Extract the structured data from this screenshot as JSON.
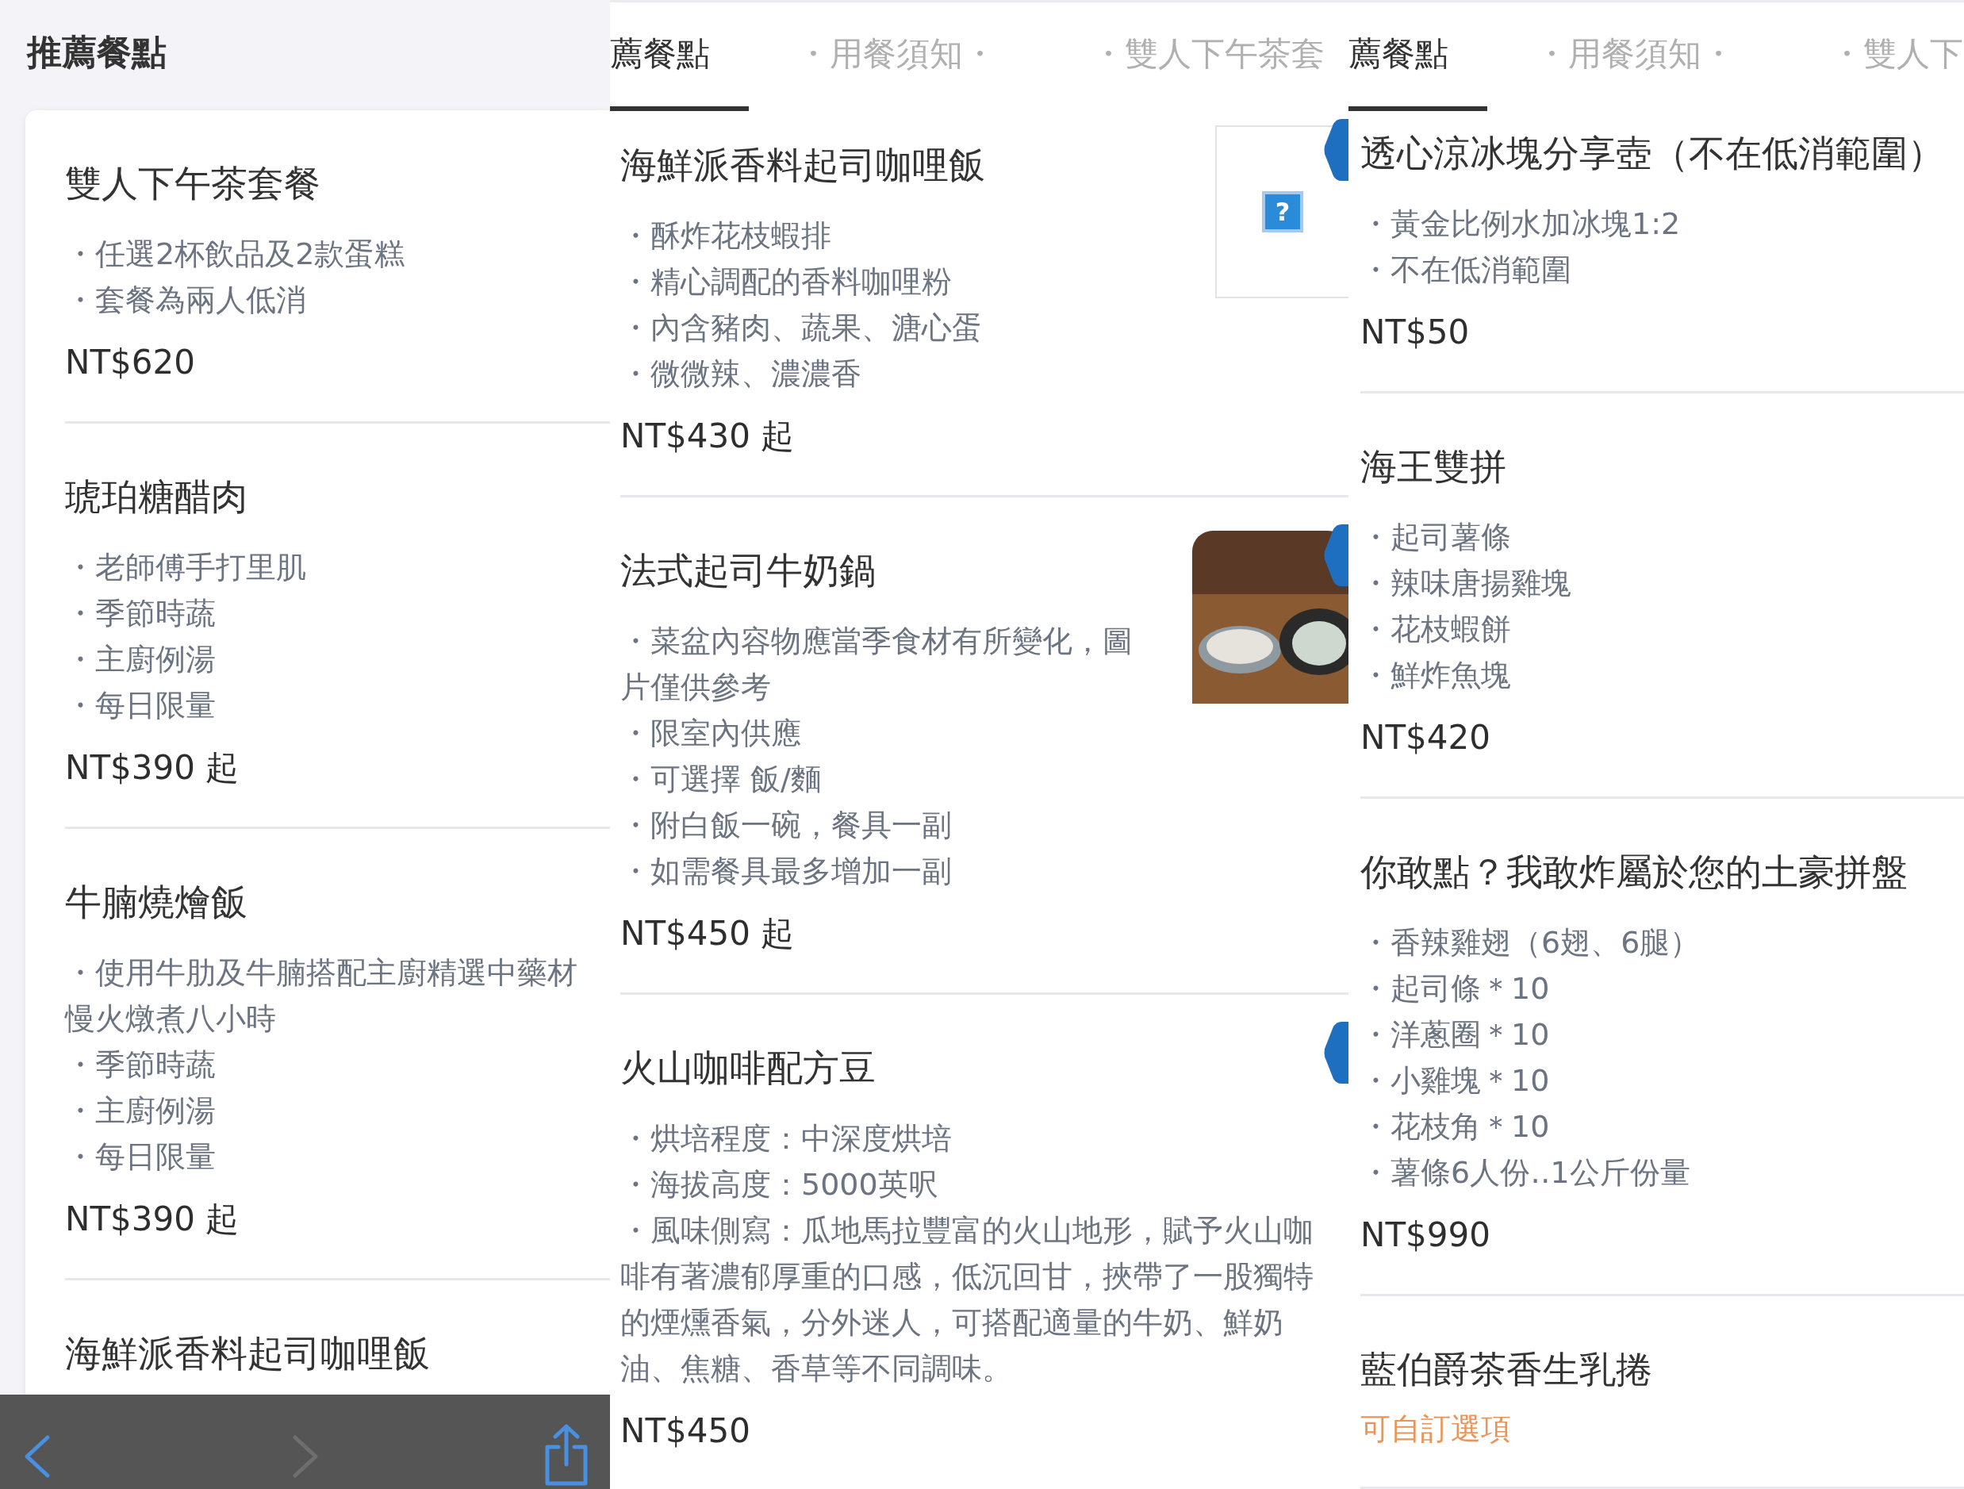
{
  "panels": [
    {
      "kind": "list",
      "header": "推薦餐點",
      "items": [
        {
          "title": "雙人下午茶套餐",
          "bullets": [
            "・任選2杯飲品及2款蛋糕",
            "・套餐為兩人低消"
          ],
          "price": "NT$620"
        },
        {
          "title": "琥珀糖醋肉",
          "bullets": [
            "・老師傅手打里肌",
            "・季節時蔬",
            "・主廚例湯",
            "・每日限量"
          ],
          "price": "NT$390 起"
        },
        {
          "title": "牛腩燒燴飯",
          "bullets": [
            "・使用牛肋及牛腩搭配主廚精選中藥材慢火燉煮八小時",
            "・季節時蔬",
            "・主廚例湯",
            "・每日限量"
          ],
          "price": "NT$390 起"
        },
        {
          "title": "海鮮派香料起司咖哩飯"
        }
      ],
      "toolbar": {
        "back": {
          "disabled": false
        },
        "forward": {
          "disabled": true
        },
        "share": {
          "disabled": false
        }
      }
    },
    {
      "kind": "tabs",
      "tabs": [
        {
          "label": "薦餐點",
          "selected": true
        },
        {
          "label": "・用餐須知・",
          "selected": false
        },
        {
          "label": "・雙人下午茶套",
          "selected": false
        }
      ],
      "items": [
        {
          "title": "海鮮派香料起司咖哩飯",
          "bullets": [
            "・酥炸花枝蝦排",
            "・精心調配的香料咖哩粉",
            "・內含豬肉、蔬果、溏心蛋",
            "・微微辣、濃濃香"
          ],
          "price": "NT$430 起",
          "image": {
            "kind": "broken",
            "icon_text": "?"
          },
          "marker": true
        },
        {
          "title": "法式起司牛奶鍋",
          "bullets": [
            "・菜盆內容物應當季食材有所變化，圖片僅供參考",
            "・限室內供應",
            "・可選擇 飯/麵",
            "・附白飯一碗，餐具一副",
            "・如需餐具最多增加一副"
          ],
          "price": "NT$450 起",
          "image": {
            "kind": "photo"
          },
          "marker": true
        },
        {
          "title": "火山咖啡配方豆",
          "bullets": [
            "・烘培程度：中深度烘培",
            "・海拔高度：5000英呎",
            "・風味側寫：瓜地馬拉豐富的火山地形，賦予火山咖啡有著濃郁厚重的口感，低沉回甘，挾帶了一股獨特的煙燻香氣，分外迷人，可搭配適量的牛奶、鮮奶油、焦糖、香草等不同調味。"
          ],
          "price": "NT$450",
          "marker": true
        }
      ]
    },
    {
      "kind": "tabs",
      "tabs": [
        {
          "label": "薦餐點",
          "selected": true
        },
        {
          "label": "・用餐須知・",
          "selected": false
        },
        {
          "label": "・雙人下",
          "selected": false
        }
      ],
      "items": [
        {
          "title": "透心涼冰塊分享壺（不在低消範圍）",
          "bullets": [
            "・黃金比例水加冰塊1:2",
            "・不在低消範圍"
          ],
          "price": "NT$50"
        },
        {
          "title": "海王雙拼",
          "bullets": [
            "・起司薯條",
            "・辣味唐揚雞塊",
            "・花枝蝦餅",
            "・鮮炸魚塊"
          ],
          "price": "NT$420"
        },
        {
          "title": "你敢點？我敢炸屬於您的土豪拼盤",
          "bullets": [
            "・香辣雞翅（6翅、6腿）",
            "・起司條＊10",
            "・洋蔥圈＊10",
            "・小雞塊＊10",
            "・花枝角＊10",
            "・薯條6人份‥1公斤份量"
          ],
          "price": "NT$990"
        },
        {
          "title": "藍伯爵茶香生乳捲",
          "tag": "可自訂選項"
        }
      ]
    }
  ]
}
